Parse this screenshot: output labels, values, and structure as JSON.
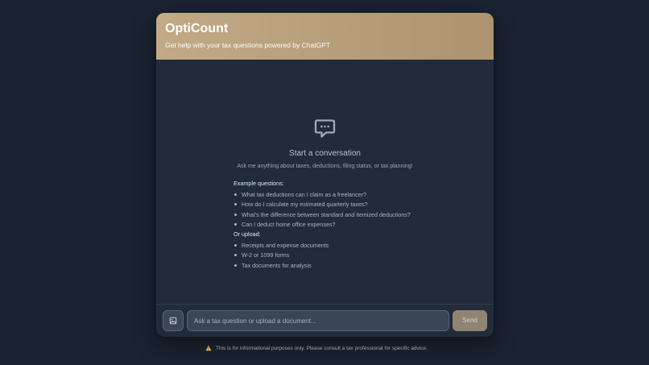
{
  "app": {
    "title": "OptiCount",
    "subtitle": "Get help with your tax questions powered by ChatGPT"
  },
  "empty_state": {
    "icon": "chat-bubble-icon",
    "title": "Start a conversation",
    "subtitle": "Ask me anything about taxes, deductions, filing status, or tax planning!"
  },
  "examples": {
    "title": "Example questions:",
    "items": [
      "What tax deductions can I claim as a freelancer?",
      "How do I calculate my estimated quarterly taxes?",
      "What's the difference between standard and itemized deductions?",
      "Can I deduct home office expenses?"
    ]
  },
  "uploads": {
    "title": "Or upload:",
    "items": [
      "Receipts and expense documents",
      "W-2 or 1099 forms",
      "Tax documents for analysis"
    ]
  },
  "composer": {
    "upload_icon": "image-upload-icon",
    "placeholder": "Ask a tax question or upload a document...",
    "send_label": "Send"
  },
  "footer": {
    "icon": "warning-icon",
    "note": "This is for informational purposes only. Please consult a tax professional for specific advice."
  },
  "colors": {
    "background": "#1b2230",
    "card": "#222b3a",
    "header_accent": "#b79f7b",
    "send_button": "#8f8572",
    "warning": "#f0b04a"
  }
}
